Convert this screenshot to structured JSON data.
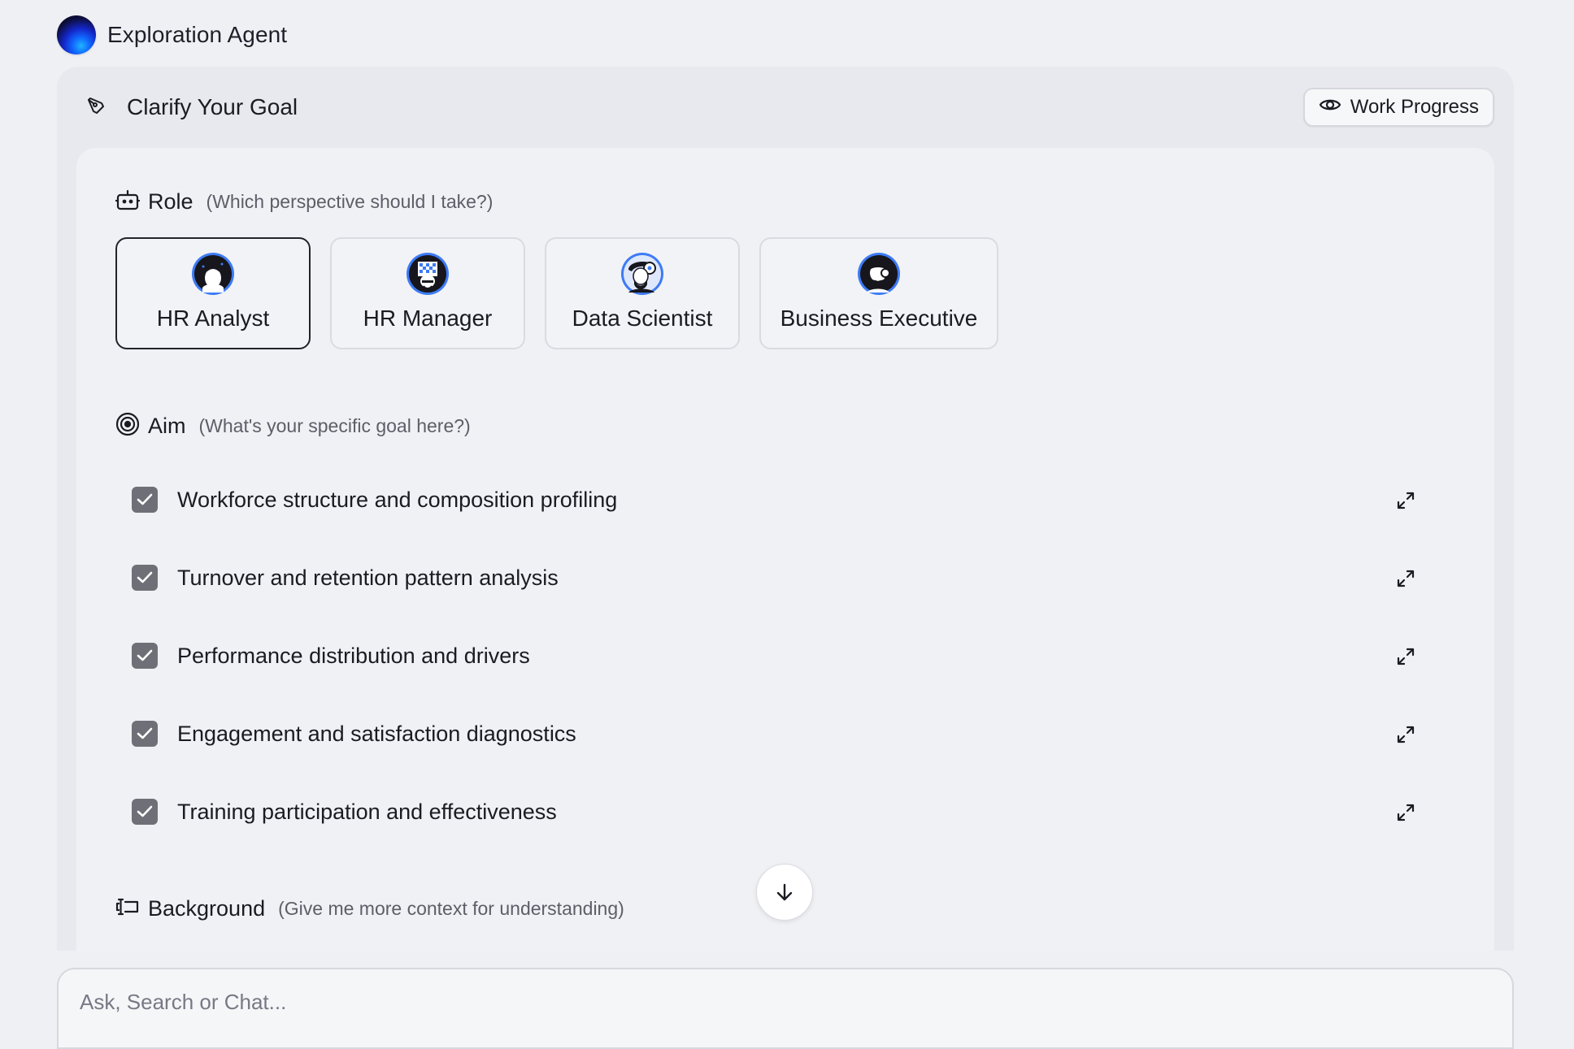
{
  "app": {
    "title": "Exploration Agent"
  },
  "panel": {
    "title": "Clarify Your Goal",
    "work_progress_label": "Work Progress"
  },
  "role": {
    "label": "Role",
    "hint": "(Which perspective should I take?)",
    "options": [
      {
        "label": "HR Analyst",
        "selected": true,
        "icon": "hr-analyst-avatar"
      },
      {
        "label": "HR Manager",
        "selected": false,
        "icon": "hr-manager-avatar"
      },
      {
        "label": "Data Scientist",
        "selected": false,
        "icon": "data-scientist-avatar"
      },
      {
        "label": "Business Executive",
        "selected": false,
        "icon": "business-executive-avatar"
      }
    ]
  },
  "aim": {
    "label": "Aim",
    "hint": "(What's your specific goal here?)",
    "items": [
      {
        "text": "Workforce structure and composition profiling",
        "checked": true
      },
      {
        "text": "Turnover and retention pattern analysis",
        "checked": true
      },
      {
        "text": "Performance distribution and drivers",
        "checked": true
      },
      {
        "text": "Engagement and satisfaction diagnostics",
        "checked": true
      },
      {
        "text": "Training participation and effectiveness",
        "checked": true
      }
    ]
  },
  "background": {
    "label": "Background",
    "hint": "(Give me more context for understanding)"
  },
  "chat": {
    "placeholder": "Ask, Search or Chat..."
  },
  "colors": {
    "page_bg": "#eff0f4",
    "checkbox": "#6f7077",
    "avatar_blue": "#3d7bf5"
  }
}
